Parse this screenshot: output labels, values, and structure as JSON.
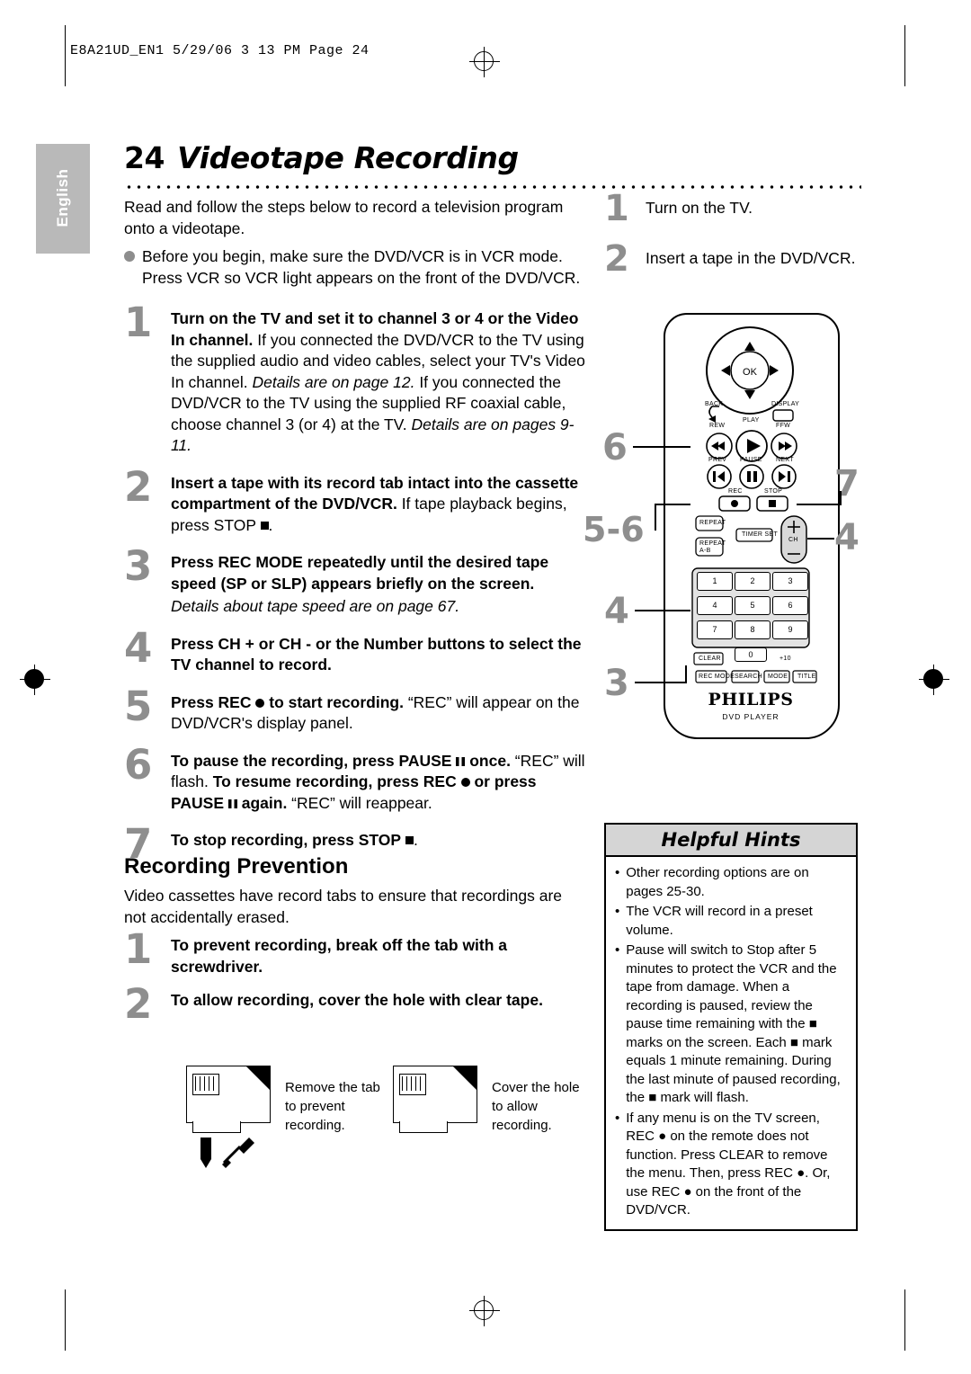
{
  "slug": "E8A21UD_EN1  5/29/06  3 13 PM  Page 24",
  "sidebar_tab": "English",
  "title": {
    "number": "24",
    "text": "Videotape Recording"
  },
  "intro": {
    "paragraph": "Read and follow the steps below to record a television program onto a videotape.",
    "bullet": "Before you begin, make sure the DVD/VCR is in VCR mode. Press VCR so VCR light appears on the front of the DVD/VCR."
  },
  "steps": [
    {
      "num": "1",
      "bold1": "Turn on the TV and set it to channel 3 or 4 or the Video In channel.",
      "normal1": " If you connected the DVD/VCR to the TV using the supplied audio and video cables, select your TV's Video In channel. ",
      "italic1": "Details are on page 12.",
      "normal2": " If you connected the DVD/VCR to the TV using the supplied RF coaxial cable, choose channel 3 (or 4) at the TV. ",
      "italic2": "Details are on pages 9-11."
    },
    {
      "num": "2",
      "bold1": "Insert a tape with its record tab intact into the cassette compartment of the DVD/VCR.",
      "normal1": " If tape playback begins, press STOP ",
      "icon": "stop-square"
    },
    {
      "num": "3",
      "bold1": "Press REC MODE repeatedly until the desired tape speed (SP or SLP) appears briefly on the screen.",
      "italic1": "Details about tape speed are on page 67."
    },
    {
      "num": "4",
      "bold1": "Press CH + or CH - or the Number buttons to select the TV channel to record."
    },
    {
      "num": "5",
      "bold1": "Press REC",
      "icon": "rec-dot",
      "bold2": " to start recording.",
      "normal1": " “REC” will appear on the DVD/VCR's display panel."
    },
    {
      "num": "6",
      "bold1": "To pause the recording, press PAUSE",
      "icon": "pause-bars",
      "bold2": " once.",
      "normal1": " “REC” will flash. ",
      "bold3": "To resume recording, press REC",
      "icon2": "rec-dot",
      "bold4": " or press PAUSE",
      "icon3": "pause-bars",
      "bold5": " again.",
      "normal2": " “REC” will reappear."
    },
    {
      "num": "7",
      "bold1": "To stop recording, press STOP",
      "icon": "stop-square"
    }
  ],
  "right_steps": [
    {
      "num": "1",
      "text": "Turn on the TV."
    },
    {
      "num": "2",
      "text": "Insert a tape in the DVD/VCR."
    }
  ],
  "remote": {
    "callouts": [
      "6",
      "7",
      "5-6",
      "4",
      "4",
      "3"
    ],
    "brand": "PHILIPS",
    "sub_brand": "DVD PLAYER",
    "ok_label": "OK",
    "labels": {
      "back": "BACK",
      "display": "DISPLAY",
      "rew": "REW",
      "play": "PLAY",
      "ffw": "FFW",
      "prev": "PREV",
      "pause": "PAUSE",
      "next": "NEXT",
      "rec": "REC",
      "stop": "STOP",
      "repeat": "REPEAT",
      "repeat_ab": "REPEAT\nA-B",
      "timer_set": "TIMER SET",
      "ch": "CH",
      "plus": "+",
      "minus": "–",
      "clear": "CLEAR",
      "plus10": "+10",
      "rec_mode": "REC MODE",
      "search": "SEARCH",
      "mode": "MODE",
      "title": "TITLE"
    },
    "numbers": [
      "1",
      "2",
      "3",
      "4",
      "5",
      "6",
      "7",
      "8",
      "9",
      "0"
    ]
  },
  "prevention": {
    "heading": "Recording Prevention",
    "body": "Video cassettes have record tabs to ensure that recordings are not accidentally erased.",
    "steps": [
      {
        "num": "1",
        "text": "To prevent recording, break off the tab with a screwdriver."
      },
      {
        "num": "2",
        "text": "To allow recording, cover the hole with clear tape."
      }
    ],
    "fig1_caption": "Remove the tab to prevent recording.",
    "fig2_caption": "Cover the hole to allow recording."
  },
  "hints": {
    "heading": "Helpful Hints",
    "items": [
      "Other recording options are on pages 25-30.",
      "The VCR will record in a preset volume.",
      "Pause will switch to Stop after 5 minutes to protect the VCR and the tape from damage. When a recording is paused, review the pause time remaining with the ■ marks on the screen. Each ■ mark equals 1 minute remaining. During the last minute of paused recording, the ■ mark will flash.",
      "If any menu is on the TV screen, REC ● on the remote does not function. Press CLEAR to remove the menu. Then, press REC ●. Or, use REC ● on the front of the DVD/VCR."
    ]
  }
}
